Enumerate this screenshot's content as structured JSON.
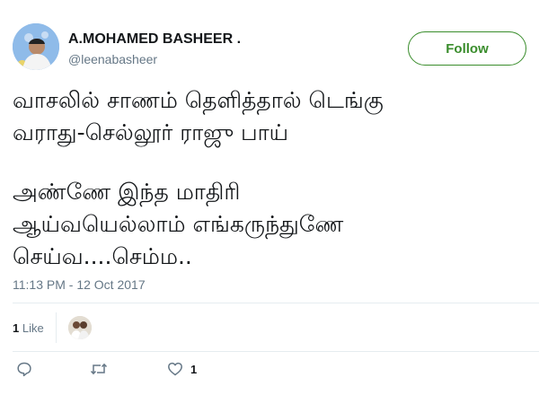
{
  "tweet": {
    "author_name": "A.MOHAMED BASHEER .",
    "author_handle": "@leenabasheer",
    "follow_label": "Follow",
    "text_lines_1": [
      "வாசலில் சாணம் தெளித்தால் டெங்கு",
      "வராது-செல்லூர் ராஜு பாய்"
    ],
    "text_lines_2": [
      "அண்ணே இந்த மாதிரி",
      "ஆய்வயெல்லாம் எங்கருந்துணே",
      "செய்வ....செம்ம.."
    ],
    "timestamp": "11:13 PM - 12 Oct 2017",
    "likes_count": "1",
    "likes_label": "Like",
    "like_action_count": "1"
  },
  "icons": {
    "reply": "reply-icon",
    "retweet": "retweet-icon",
    "like": "heart-icon"
  },
  "colors": {
    "follow_accent": "#3a8d2c",
    "muted": "#657786",
    "divider": "#e6ecf0"
  }
}
